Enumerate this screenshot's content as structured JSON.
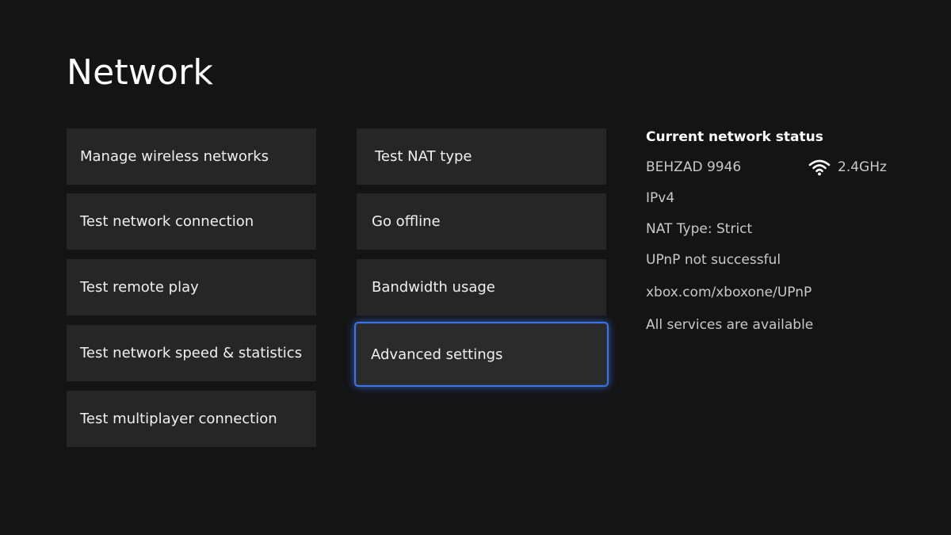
{
  "page": {
    "title": "Network"
  },
  "menu": {
    "column1": [
      {
        "label": "Manage wireless networks"
      },
      {
        "label": "Test network connection"
      },
      {
        "label": "Test remote play"
      },
      {
        "label": "Test network speed & statistics"
      },
      {
        "label": "Test multiplayer connection"
      }
    ],
    "column2": [
      {
        "label": "Test NAT type"
      },
      {
        "label": "Go offline"
      },
      {
        "label": "Bandwidth usage"
      },
      {
        "label": "Advanced settings",
        "focused": true
      }
    ]
  },
  "status": {
    "heading": "Current network status",
    "network_name": "BEHZAD 9946",
    "band": "2.4GHz",
    "wifi_icon": "wifi-icon",
    "ip_version": "IPv4",
    "nat_type": "NAT Type: Strict",
    "upnp": "UPnP not successful",
    "upnp_link": "xbox.com/xboxone/UPnP",
    "services": "All services are available"
  },
  "colors": {
    "background": "#141414",
    "tile": "#262626",
    "focus_border": "#3b74e6",
    "secondary_text": "#c9c9c9"
  }
}
